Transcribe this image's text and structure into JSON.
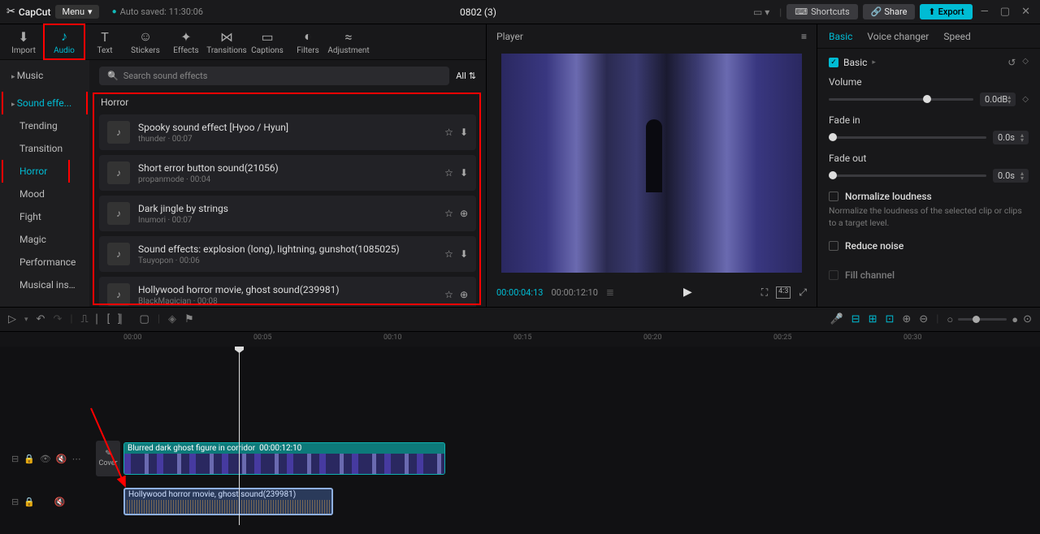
{
  "titlebar": {
    "app": "CapCut",
    "menu": "Menu",
    "autosave": "Auto saved: 11:30:06",
    "project": "0802 (3)",
    "shortcuts": "Shortcuts",
    "share": "Share",
    "export": "Export"
  },
  "top_tabs": [
    {
      "label": "Import",
      "icon": "⬇"
    },
    {
      "label": "Audio",
      "icon": "♪"
    },
    {
      "label": "Text",
      "icon": "T"
    },
    {
      "label": "Stickers",
      "icon": "☺"
    },
    {
      "label": "Effects",
      "icon": "✦"
    },
    {
      "label": "Transitions",
      "icon": "⋈"
    },
    {
      "label": "Captions",
      "icon": "▭"
    },
    {
      "label": "Filters",
      "icon": "◐"
    },
    {
      "label": "Adjustment",
      "icon": "≈"
    }
  ],
  "sidebar": {
    "music": "Music",
    "sound_effects": "Sound effe...",
    "items": [
      "Trending",
      "Transition",
      "Horror",
      "Mood",
      "Fight",
      "Magic",
      "Performance",
      "Musical inst..."
    ]
  },
  "search": {
    "placeholder": "Search sound effects",
    "filter": "All"
  },
  "section": "Horror",
  "sounds": [
    {
      "title": "Spooky sound effect [Hyoo / Hyun]",
      "meta": "thunder · 00:07",
      "dl": true
    },
    {
      "title": "Short error button sound(21056)",
      "meta": "propanmode · 00:04",
      "dl": true
    },
    {
      "title": "Dark jingle by strings",
      "meta": "Inumori · 00:07",
      "dl": false
    },
    {
      "title": "Sound effects: explosion (long), lightning, gunshot(1085025)",
      "meta": "Tsuyopon · 00:06",
      "dl": true
    },
    {
      "title": "Hollywood horror movie, ghost sound(239981)",
      "meta": "BlackMagician · 00:08",
      "dl": false
    }
  ],
  "player": {
    "title": "Player",
    "cur": "00:00:04:13",
    "dur": "00:00:12:10"
  },
  "inspector": {
    "tabs": [
      "Basic",
      "Voice changer",
      "Speed"
    ],
    "section": "Basic",
    "volume": {
      "label": "Volume",
      "value": "0.0dB"
    },
    "fadein": {
      "label": "Fade in",
      "value": "0.0s"
    },
    "fadeout": {
      "label": "Fade out",
      "value": "0.0s"
    },
    "normalize": {
      "label": "Normalize loudness",
      "help": "Normalize the loudness of the selected clip or clips to a target level."
    },
    "reduce": {
      "label": "Reduce noise"
    },
    "fill": {
      "label": "Fill channel"
    }
  },
  "timeline": {
    "ticks": [
      "00:00",
      "00:05",
      "00:10",
      "00:15",
      "00:20",
      "00:25",
      "00:30"
    ],
    "cover": "Cover",
    "video_clip": {
      "label": "Blurred dark ghost figure in corridor",
      "dur": "00:00:12:10"
    },
    "audio_clip": {
      "label": "Hollywood horror movie, ghost sound(239981)"
    }
  }
}
